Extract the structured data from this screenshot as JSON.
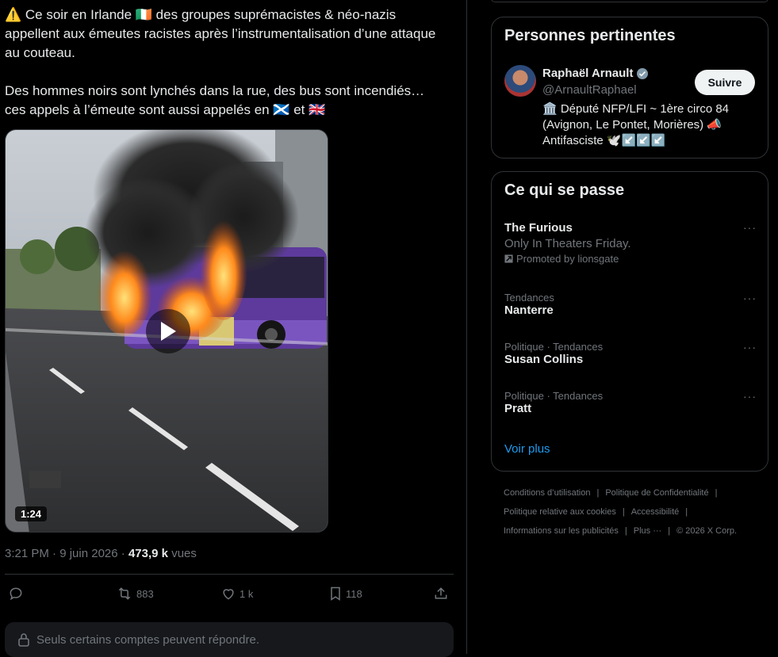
{
  "tweet": {
    "text": "⚠️ Ce soir en Irlande 🇮🇪 des groupes suprémacistes & néo-nazis appellent aux émeutes racistes après l’instrumentalisation d’une attaque au couteau.\n\nDes hommes noirs sont lynchés dans la rue, des bus sont incendiés… ces appels à l’émeute sont aussi appelés en 🏴󠁧󠁢󠁳󠁣󠁴󠁿 et 🇬🇧",
    "video_duration": "1:24",
    "time": "3:21 PM",
    "date": "9 juin 2026",
    "views_count": "473,9 k",
    "views_label": "vues",
    "retweets": "883",
    "likes": "1 k",
    "bookmarks": "118",
    "reply_restriction": "Seuls certains comptes peuvent répondre."
  },
  "relevant": {
    "title": "Personnes pertinentes",
    "name": "Raphaël Arnault",
    "handle": "@ArnaultRaphael",
    "bio": "🏛️ Député NFP/LFI ~ 1ère circo 84 (Avignon, Le Pontet, Morières) 📣 Antifasciste 🕊️↙️↙️↙️",
    "follow_label": "Suivre"
  },
  "happening": {
    "title": "Ce qui se passe",
    "promo": {
      "title": "The Furious",
      "subtitle": "Only In Theaters Friday.",
      "promoted": "Promoted by lionsgate"
    },
    "trends": [
      {
        "context": "Tendances",
        "name": "Nanterre"
      },
      {
        "context": "Politique · Tendances",
        "name": "Susan Collins"
      },
      {
        "context": "Politique · Tendances",
        "name": "Pratt"
      }
    ],
    "show_more": "Voir plus"
  },
  "footer": {
    "terms": "Conditions d’utilisation",
    "privacy": "Politique de Confidentialité",
    "cookies": "Politique relative aux cookies",
    "accessibility": "Accessibilité",
    "ads": "Informations sur les publicités",
    "more": "Plus ···",
    "copyright": "© 2026 X Corp."
  },
  "colors": {
    "accent": "#1d9bf0",
    "bus_purple": "#6b3fa8",
    "verified": "#829aab"
  }
}
